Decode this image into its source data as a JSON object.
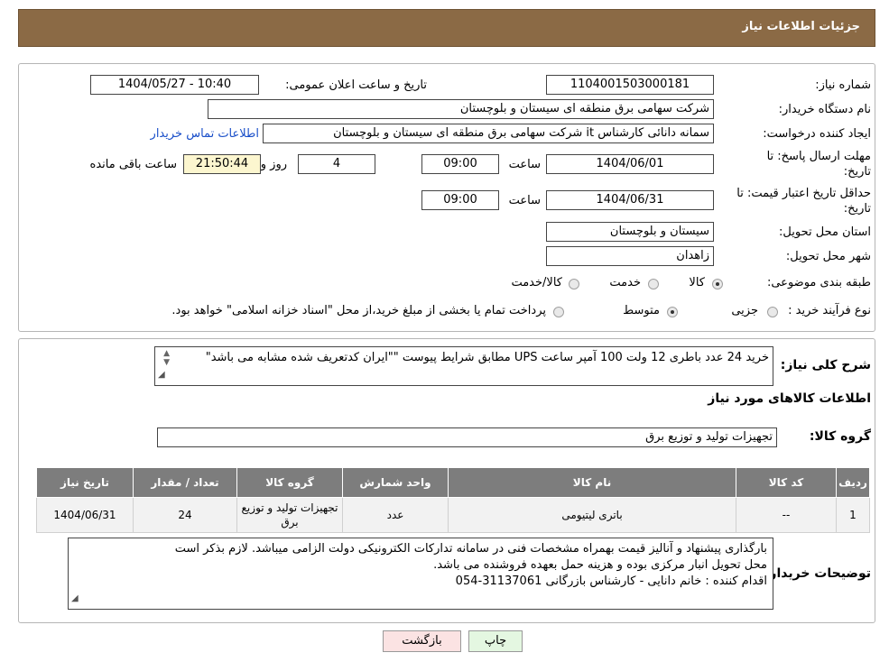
{
  "header": {
    "title": "جزئیات اطلاعات نیاز"
  },
  "fields": {
    "need_number_label": "شماره نیاز:",
    "need_number": "1104001503000181",
    "announce_label": "تاریخ و ساعت اعلان عمومی:",
    "announce_value": "1404/05/27 - 10:40",
    "buyer_org_label": "نام دستگاه خریدار:",
    "buyer_org": "شرکت سهامی برق منطقه ای سیستان و بلوچستان",
    "creator_label": "ایجاد کننده درخواست:",
    "creator": "سمانه دانائی کارشناس it شرکت سهامی برق منطقه ای سیستان و بلوچستان",
    "contact_link": "اطلاعات تماس خریدار",
    "deadline_label": "مهلت ارسال پاسخ: تا تاریخ:",
    "deadline_date": "1404/06/01",
    "time_label": "ساعت",
    "deadline_time": "09:00",
    "days_value": "4",
    "days_label": "روز و",
    "remaining_time": "21:50:44",
    "remaining_label": "ساعت باقی مانده",
    "validity_label": "حداقل تاریخ اعتبار قیمت: تا تاریخ:",
    "validity_date": "1404/06/31",
    "validity_time": "09:00",
    "province_label": "استان محل تحویل:",
    "province": "سیستان و بلوچستان",
    "city_label": "شهر محل تحویل:",
    "city": "زاهدان",
    "category_label": "طبقه بندی موضوعی:",
    "category_options": [
      "کالا",
      "خدمت",
      "کالا/خدمت"
    ],
    "purchase_type_label": "نوع فرآیند خرید :",
    "purchase_options": [
      "جزیی",
      "متوسط"
    ],
    "purchase_note": "پرداخت تمام یا بخشی از مبلغ خرید،از محل \"اسناد خزانه اسلامی\" خواهد بود."
  },
  "description": {
    "label": "شرح کلی نیاز:",
    "text": "خرید 24 عدد باطری 12 ولت 100 آمپر ساعت UPS مطابق شرایط پیوست \"\"ایران کدتعریف شده مشابه می باشد\""
  },
  "goods": {
    "section_title": "اطلاعات کالاهای مورد نیاز",
    "group_label": "گروه کالا:",
    "group_value": "تجهیزات تولید و توزیع برق",
    "columns": [
      "ردیف",
      "کد کالا",
      "نام کالا",
      "واحد شمارش",
      "گروه کالا",
      "تعداد / مقدار",
      "تاریخ نیاز"
    ],
    "rows": [
      [
        "1",
        "--",
        "باتری لیتیومی",
        "عدد",
        "تجهیزات تولید و توزیع برق",
        "24",
        "1404/06/31"
      ]
    ]
  },
  "buyer_notes": {
    "label": "توضیحات خریدار:",
    "lines": [
      "بارگذاری پیشنهاد و آنالیز قیمت بهمراه مشخصات فنی در سامانه تدارکات الکترونیکی دولت الزامی میباشد. لازم بذکر است",
      "محل تحویل انبار مرکزی بوده و هزینه حمل بعهده فروشنده می باشد.",
      "اقدام کننده : خانم دانایی - کارشناس بازرگانی 31137061-054"
    ]
  },
  "buttons": {
    "print": "چاپ",
    "back": "بازگشت"
  },
  "colors": {
    "header_bg": "#8b6a45",
    "print_bg": "#e4f7e1",
    "back_bg": "#fbe3e3",
    "table_header_bg": "#7d7d7d"
  }
}
